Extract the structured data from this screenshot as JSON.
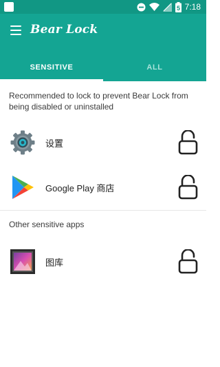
{
  "status_bar": {
    "time": "7:18",
    "battery_level": "5",
    "icons": [
      "notification-icon",
      "dnd-icon",
      "wifi-icon",
      "signal-icon",
      "battery-icon"
    ]
  },
  "app_bar": {
    "title": "Bear Lock",
    "menu_icon": "hamburger-menu-icon",
    "color": "#14a593"
  },
  "tabs": [
    {
      "label": "SENSITIVE",
      "active": true
    },
    {
      "label": "ALL",
      "active": false
    }
  ],
  "description": "Recommended to lock to prevent Bear Lock from being disabled or uninstalled",
  "recommended_apps": [
    {
      "name": "设置",
      "icon": "settings-gear-icon",
      "locked": false
    },
    {
      "name": "Google Play 商店",
      "icon": "google-play-icon",
      "locked": false
    }
  ],
  "other_header": "Other sensitive apps",
  "other_apps": [
    {
      "name": "图库",
      "icon": "gallery-icon",
      "locked": false
    }
  ]
}
